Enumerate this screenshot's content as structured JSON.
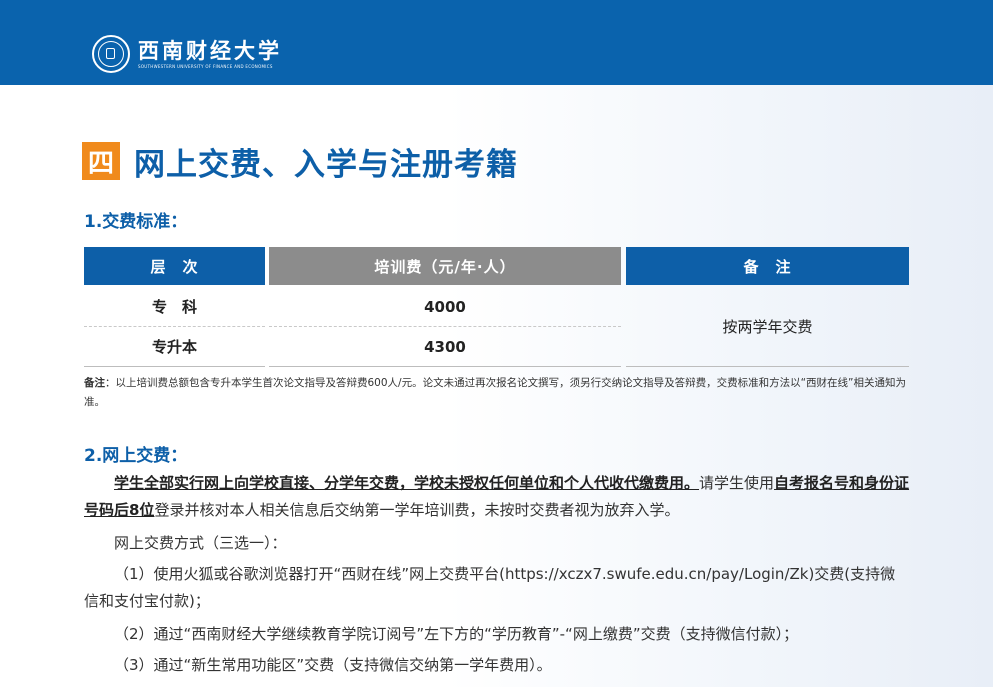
{
  "header": {
    "school_name_cn": "西南财经大学",
    "school_name_en": "SOUTHWESTERN UNIVERSITY OF FINANCE AND ECONOMICS"
  },
  "section": {
    "number": "四",
    "title": "网上交费、入学与注册考籍"
  },
  "fee_standard": {
    "heading": "1.交费标准：",
    "columns": [
      "层　次",
      "培训费（元/年·人）",
      "备　注"
    ],
    "rows": [
      {
        "level": "专　科",
        "fee": "4000"
      },
      {
        "level": "专升本",
        "fee": "4300"
      }
    ],
    "note_cell": "按两学年交费",
    "footnote_label": "备注",
    "footnote_text": "：以上培训费总额包含专升本学生首次论文指导及答辩费600人/元。论文未通过再次报名论文撰写，须另行交纳论文指导及答辩费，交费标准和方法以“西财在线”相关通知为准。"
  },
  "online_payment": {
    "heading": "2.网上交费：",
    "p1_bold": "学生全部实行网上向学校直接、分学年交费，学校未授权任何单位和个人代收代缴费用。",
    "p1_text1": "请学生使用",
    "p1_bold2": "自考报名号和身份证号码后8位",
    "p1_text2": "登录并核对本人相关信息后交纳第一学年培训费，未按时交费者视为放弃入学。",
    "methods_intro": "网上交费方式（三选一）：",
    "method1": "（1）使用火狐或谷歌浏览器打开“西财在线”网上交费平台(https://xczx7.swufe.edu.cn/pay/Login/Zk)交费(支持微信和支付宝付款)；",
    "method2": "（2）通过“西南财经大学继续教育学院订阅号”左下方的“学历教育”-“网上缴费”交费（支持微信付款）；",
    "method3": "（3）通过“新生常用功能区”交费（支持微信交纳第一学年费用）。"
  },
  "colors": {
    "header_blue": "#0a63ad",
    "title_blue": "#0d5fa8",
    "accent_orange": "#f08a1c",
    "header_gray": "#8c8c8c"
  }
}
